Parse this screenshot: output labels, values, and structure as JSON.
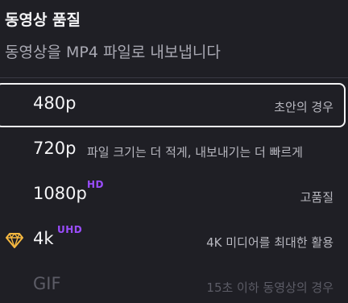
{
  "header": {
    "title": "동영상 품질",
    "subtitle": "동영상을 MP4 파일로 내보냅니다"
  },
  "options": [
    {
      "label": "480p",
      "description": "초안의 경우",
      "badge": "",
      "selected": true
    },
    {
      "label": "720p",
      "description": "파일 크기는 더 적게, 내보내기는 더 빠르게",
      "badge": ""
    },
    {
      "label": "1080p",
      "description": "고품질",
      "badge": "HD"
    },
    {
      "label": "4k",
      "description": "4K 미디어를 최대한 활용",
      "badge": "UHD",
      "icon": "premium-gem-icon"
    },
    {
      "label": "GIF",
      "description": "15초 이하 동영상의 경우",
      "badge": "",
      "disabled": true
    }
  ],
  "colors": {
    "background": "#1f1f25",
    "badge": "#9b4dff",
    "gem": "#f5b840",
    "selected_border": "#f3f3f5"
  }
}
